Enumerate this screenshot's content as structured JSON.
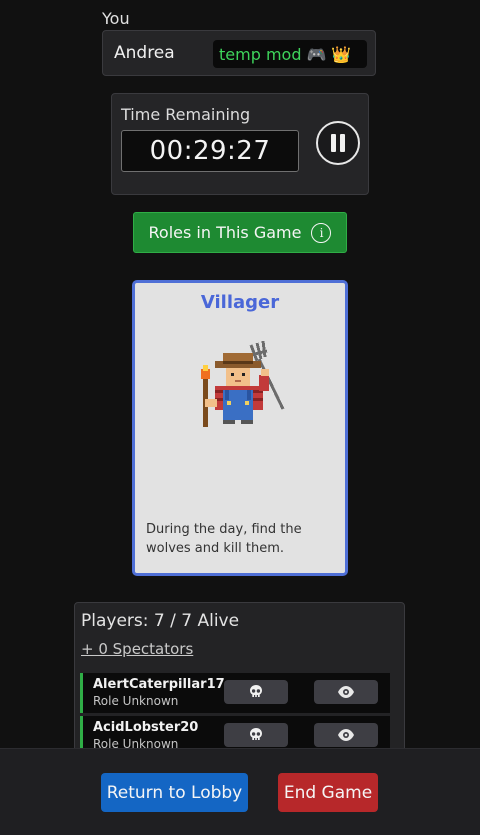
{
  "user": {
    "label": "You",
    "name": "Andrea",
    "badge_text": "temp mod",
    "badge_emojis": [
      "🎮",
      "👑"
    ]
  },
  "timer": {
    "label": "Time Remaining",
    "value": "00:29:27",
    "control_icon": "pause-icon"
  },
  "roles_button": {
    "label": "Roles in This Game",
    "icon": "info-icon"
  },
  "role_card": {
    "title": "Villager",
    "image": "villager-farmer-pitchfork-torch",
    "description": "During the day, find the wolves and kill them."
  },
  "players": {
    "count_text": "Players: 7 / 7 Alive",
    "spectators_text": "+ 0 Spectators",
    "rows": [
      {
        "name": "AlertCaterpillar17",
        "role": "Role Unknown",
        "kill_icon": "skull-icon",
        "view_icon": "eye-icon"
      },
      {
        "name": "AcidLobster20",
        "role": "Role Unknown",
        "kill_icon": "skull-icon",
        "view_icon": "eye-icon"
      }
    ]
  },
  "footer": {
    "lobby_label": "Return to Lobby",
    "end_label": "End Game"
  },
  "colors": {
    "background": "#111111",
    "green": "#1e8a32",
    "blue": "#1466c4",
    "red": "#b7282a",
    "role_title": "#4a67d8"
  }
}
